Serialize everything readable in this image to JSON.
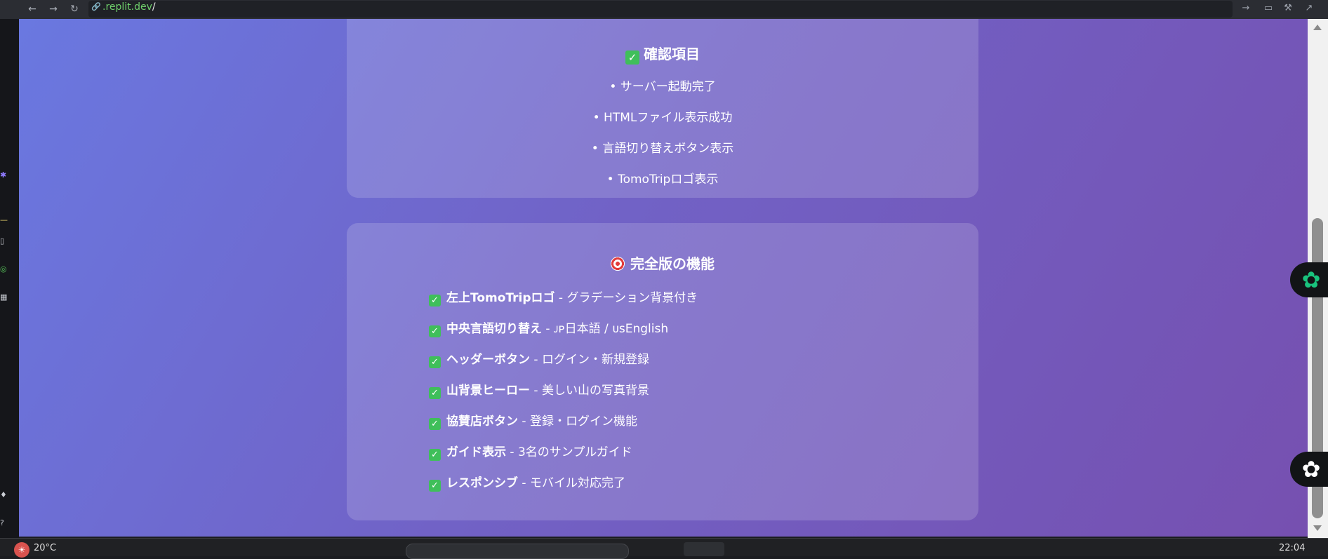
{
  "browser": {
    "url_domain": ".replit.dev",
    "url_slash": "/"
  },
  "card1": {
    "title": "確認項目",
    "items": [
      "• サーバー起動完了",
      "• HTMLファイル表示成功",
      "• 言語切り替えボタン表示",
      "• TomoTripロゴ表示"
    ]
  },
  "card2": {
    "title": "完全版の機能",
    "features": [
      {
        "bold": "左上TomoTripロゴ",
        "rest": " - グラデーション背景付き"
      },
      {
        "bold": "中央言語切り替え",
        "rest": " - ᴊᴘ日本語 / ᴜsEnglish"
      },
      {
        "bold": "ヘッダーボタン",
        "rest": " - ログイン・新規登録"
      },
      {
        "bold": "山背景ヒーロー",
        "rest": " - 美しい山の写真背景"
      },
      {
        "bold": "協賛店ボタン",
        "rest": " - 登録・ログイン機能"
      },
      {
        "bold": "ガイド表示",
        "rest": " - 3名のサンプルガイド"
      },
      {
        "bold": "レスポンシブ",
        "rest": " - モバイル対応完了"
      }
    ]
  },
  "taskbar": {
    "left_text": "20°C",
    "clock": "22:04"
  },
  "colors": {
    "gradient_start": "#6a78e0",
    "gradient_end": "#7650b0",
    "check_green": "#3fbf5a",
    "url_green": "#6fcf6b"
  }
}
